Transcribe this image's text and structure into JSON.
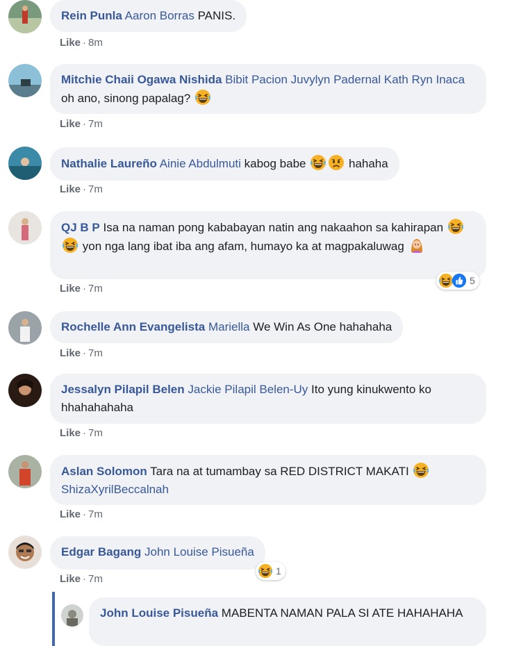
{
  "like_label": "Like",
  "separator": "·",
  "icons": {
    "laugh": "laugh-emoji-icon",
    "sad": "sad-emoji-icon",
    "woman": "woman-emoji-icon",
    "like": "like-reaction-icon"
  },
  "colors": {
    "name": "#385898",
    "bubble": "#f0f2f5",
    "meta": "#606770",
    "reply_line": "#4267b2"
  },
  "comments": [
    {
      "author": "Rein Punla",
      "mention": "Aaron Borras",
      "text": "PANIS.",
      "time": "8m"
    },
    {
      "author": "Mitchie Chaii Ogawa Nishida",
      "mention": "Bibit Pacion Juvylyn Padernal Kath Ryn Inaca",
      "text": "oh ano, sinong papalag?",
      "time": "7m"
    },
    {
      "author": "Nathalie Laureño",
      "mention": "Ainie Abdulmuti",
      "text": "kabog babe",
      "text2": "hahaha",
      "time": "7m"
    },
    {
      "author": "QJ B P",
      "text": "Isa na naman pong kababayan natin ang nakaahon sa kahirapan",
      "text2": "yon nga lang ibat iba ang afam, humayo ka at magpakaluwag",
      "time": "7m",
      "reaction_count": "5"
    },
    {
      "author": "Rochelle Ann Evangelista",
      "mention": "Mariella",
      "text": "We Win As One hahahaha",
      "time": "7m"
    },
    {
      "author": "Jessalyn Pilapil Belen",
      "mention": "Jackie Pilapil Belen-Uy",
      "text": "Ito yung kinukwento ko hhahahahaha",
      "time": "7m"
    },
    {
      "author": "Aslan Solomon",
      "text": "Tara na at tumambay sa RED DISTRICT MAKATI",
      "mention": "ShizaXyrilBeccalnah",
      "time": "7m"
    },
    {
      "author": "Edgar Bagang",
      "mention": "John Louise Pisueña",
      "time": "7m",
      "reaction_count": "1"
    }
  ],
  "reply": {
    "author": "John Louise Pisueña",
    "text": "MABENTA NAMAN PALA SI ATE HAHAHAHA"
  }
}
